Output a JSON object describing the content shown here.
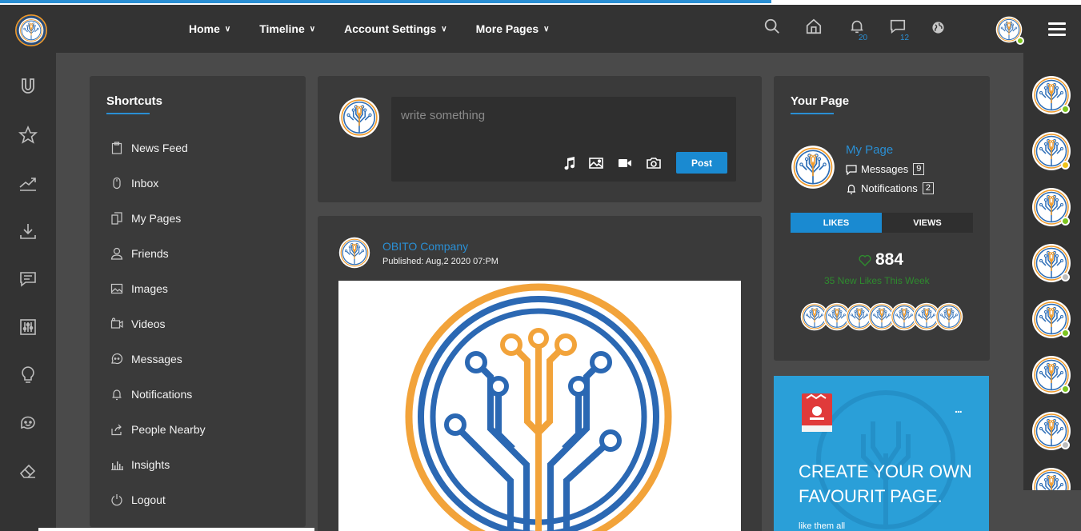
{
  "nav": {
    "items": [
      {
        "label": "Home"
      },
      {
        "label": "Timeline"
      },
      {
        "label": "Account Settings"
      },
      {
        "label": "More Pages"
      }
    ],
    "notifications_count": "20",
    "messages_count": "12"
  },
  "shortcuts": {
    "title": "Shortcuts",
    "items": [
      {
        "label": "News Feed",
        "icon": "clipboard-icon"
      },
      {
        "label": "Inbox",
        "icon": "mouse-icon"
      },
      {
        "label": "My Pages",
        "icon": "pages-icon"
      },
      {
        "label": "Friends",
        "icon": "user-icon"
      },
      {
        "label": "Images",
        "icon": "image-icon"
      },
      {
        "label": "Videos",
        "icon": "video-icon"
      },
      {
        "label": "Messages",
        "icon": "chat-icon"
      },
      {
        "label": "Notifications",
        "icon": "bell-icon"
      },
      {
        "label": "People Nearby",
        "icon": "share-icon"
      },
      {
        "label": "Insights",
        "icon": "bar-chart-icon"
      },
      {
        "label": "Logout",
        "icon": "power-icon"
      }
    ]
  },
  "composer": {
    "placeholder": "write something",
    "post_label": "Post"
  },
  "post": {
    "author": "OBITO Company",
    "published": "Published: Aug,2 2020 07:PM"
  },
  "your_page": {
    "title": "Your Page",
    "page_name": "My Page",
    "messages_label": "Messages",
    "messages_count": "9",
    "notifications_label": "Notifications",
    "notifications_count": "2",
    "tab_likes": "LIKES",
    "tab_views": "VIEWS",
    "likes": "884",
    "likes_week": "35 New Likes This Week"
  },
  "promo": {
    "title": "CREATE YOUR OWN FAVOURIT PAGE.",
    "subtitle": "like them all",
    "more": "..."
  },
  "colors": {
    "accent": "#1a8ad1",
    "rail": "#333333",
    "panel": "#3a3a3a",
    "online": "#7cc520",
    "away": "#f0c419",
    "offline": "#bdbdbd"
  },
  "right_rail_status": [
    "online",
    "away",
    "online",
    "offline",
    "online",
    "online",
    "offline",
    "online"
  ]
}
